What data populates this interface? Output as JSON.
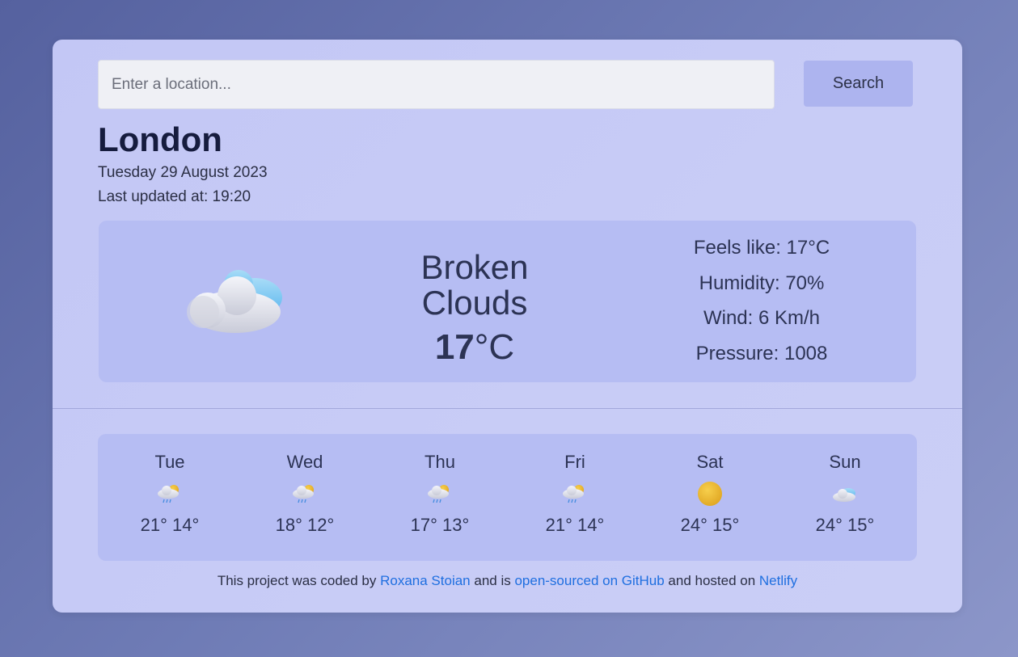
{
  "search": {
    "placeholder": "Enter a location...",
    "button_label": "Search"
  },
  "location": {
    "city": "London",
    "date": "Tuesday 29 August 2023",
    "last_updated": "Last updated at: 19:20"
  },
  "current": {
    "icon": "broken-clouds-icon",
    "description_line1": "Broken",
    "description_line2": "Clouds",
    "temperature": "17",
    "unit": "°C",
    "feels_like": "Feels like: 17°C",
    "humidity": "Humidity: 70%",
    "wind": "Wind: 6 Km/h",
    "pressure": "Pressure: 1008"
  },
  "forecast": [
    {
      "day": "Tue",
      "icon": "sun-rain-cloud-icon",
      "range": "21° 14°"
    },
    {
      "day": "Wed",
      "icon": "sun-rain-cloud-icon",
      "range": "18° 12°"
    },
    {
      "day": "Thu",
      "icon": "sun-rain-cloud-icon",
      "range": "17° 13°"
    },
    {
      "day": "Fri",
      "icon": "sun-rain-cloud-icon",
      "range": "21° 14°"
    },
    {
      "day": "Sat",
      "icon": "sun-icon",
      "range": "24° 15°"
    },
    {
      "day": "Sun",
      "icon": "cloud-icon",
      "range": "24° 15°"
    }
  ],
  "footer": {
    "text1": "This project was coded by ",
    "author_link": "Roxana Stoian",
    "text2": " and is ",
    "github_link": "open-sourced on GitHub",
    "text3": " and hosted on ",
    "netlify_link": "Netlify"
  },
  "colors": {
    "page_bg": "#6f7cb6",
    "card_bg": "#c6caf6",
    "panel_bg": "#b6bdf3",
    "button_bg": "#adb4ef",
    "link": "#1f6fe0",
    "heading": "#161c3e"
  }
}
